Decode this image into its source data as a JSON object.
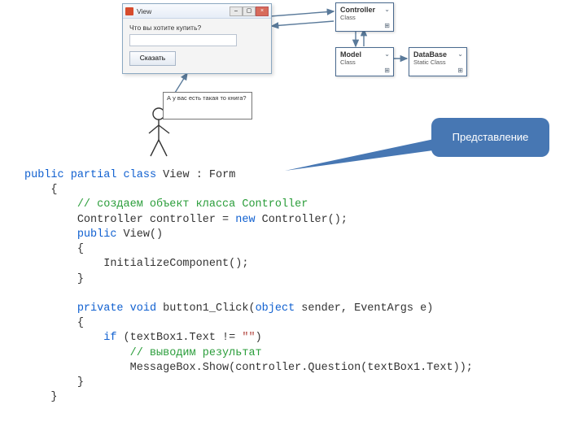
{
  "window": {
    "title": "View",
    "prompt": "Что вы хотите купить?",
    "button": "Сказать"
  },
  "uml": {
    "controller": {
      "name": "Controller",
      "sub": "Class"
    },
    "model": {
      "name": "Model",
      "sub": "Class"
    },
    "database": {
      "name": "DataBase",
      "sub": "Static Class"
    }
  },
  "speech": "А у вас есть такая то книга?",
  "callout": "Представление",
  "code": {
    "kw_public": "public",
    "kw_partial": "partial",
    "kw_class": "class",
    "cls_view": "View",
    "colon": ": Form",
    "brace_o": "{",
    "brace_c": "}",
    "cm1": "// создаем объект класса Controller",
    "l_ctrl": "Controller controller = ",
    "kw_new": "new",
    "l_ctrl2": " Controller();",
    "ctor": " View()",
    "init": "InitializeComponent();",
    "kw_private": "private",
    "kw_void": "void",
    "m_click": " button1_Click(",
    "kw_object": "object",
    "m_click2": " sender, EventArgs e)",
    "kw_if": "if",
    "cond": " (textBox1.Text != ",
    "str_empty": "\"\"",
    "cond2": ")",
    "cm2": "// выводим результат",
    "msg": "MessageBox.Show(controller.Question(textBox1.Text));"
  }
}
